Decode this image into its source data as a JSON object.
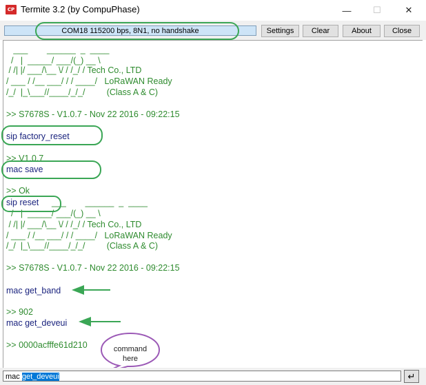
{
  "window": {
    "title": "Termite 3.2 (by CompuPhase)",
    "icon_text": "CP",
    "minimize": "—",
    "maximize": "☐",
    "close": "✕"
  },
  "toolbar": {
    "status": "COM18 115200 bps, 8N1, no handshake",
    "settings_label": "Settings",
    "clear_label": "Clear",
    "about_label": "About",
    "close_label": "Close"
  },
  "terminal": {
    "lines": [
      {
        "text": "   ___        ______  _  ____",
        "color": "green"
      },
      {
        "text": "  /   |  _____/ ___/(_) __ \\",
        "color": "green"
      },
      {
        "text": " / /| |/ ___/\\__ \\/ / /_/ / Tech Co., LTD",
        "color": "green"
      },
      {
        "text": "/ ___ / /__ ___/ / / ____/   LoRaWAN Ready",
        "color": "green"
      },
      {
        "text": "/_/  |_\\___//____/_/_/         (Class A & C)",
        "color": "green"
      },
      {
        "text": ">> S7678S - V1.0.7 - Nov 22 2016 - 09:22:15",
        "color": "green"
      },
      {
        "text": "sip factory_reset",
        "color": "blue"
      },
      {
        "text": ">> V1.0.7",
        "color": "green"
      },
      {
        "text": "mac save",
        "color": "blue"
      },
      {
        "text": ">> Ok",
        "color": "green"
      },
      {
        "text": "sip reset",
        "color": "blue"
      },
      {
        "text": "___        ______  _  ____",
        "color": "green"
      },
      {
        "text": "  /   |  _____/ ___/(_) __ \\",
        "color": "green"
      },
      {
        "text": " / /| |/ ___/\\__ \\/ / /_/ / Tech Co., LTD",
        "color": "green"
      },
      {
        "text": "/ ___ / /__ ___/ / / ____/   LoRaWAN Ready",
        "color": "green"
      },
      {
        "text": "/_/  |_\\___//____/_/_/         (Class A & C)",
        "color": "green"
      },
      {
        "text": ">> S7678S - V1.0.7 - Nov 22 2016 - 09:22:15",
        "color": "green"
      },
      {
        "text": "mac get_band",
        "color": "blue"
      },
      {
        "text": ">> 902",
        "color": "green"
      },
      {
        "text": "mac get_deveui",
        "color": "blue"
      },
      {
        "text": ">> 0000acfffe61d210",
        "color": "green"
      }
    ]
  },
  "callout": {
    "line1": "command",
    "line2": "here"
  },
  "input": {
    "prefix": "mac ",
    "selected": "get_deveui",
    "enter_symbol": "↵"
  },
  "colors": {
    "annotation": "#3aa655",
    "callout_border": "#9b59b6",
    "output": "#2e8b2e",
    "command": "#1a237e"
  }
}
